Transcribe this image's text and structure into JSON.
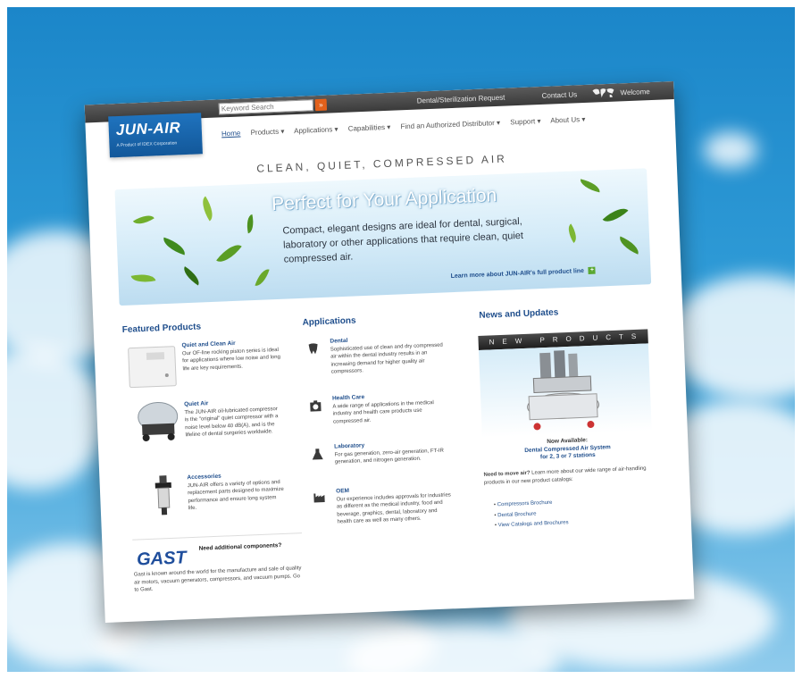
{
  "topbar": {
    "search_placeholder": "Keyword Search",
    "search_button": "»",
    "links": [
      "Dental/Sterilization Request",
      "Contact Us",
      "Welcome"
    ]
  },
  "logo": {
    "name": "JUN-AIR",
    "tagline": "A Product of IDEX Corporation"
  },
  "nav": {
    "items": [
      "Home",
      "Products ▾",
      "Applications ▾",
      "Capabilities ▾",
      "Find an Authorized Distributor ▾",
      "Support ▾",
      "About Us ▾"
    ]
  },
  "headline": "CLEAN, QUIET, COMPRESSED AIR",
  "banner": {
    "title": "Perfect for Your Application",
    "body": "Compact, elegant designs are ideal for dental, surgical, laboratory or other applications that require clean, quiet compressed air.",
    "link": "Learn more about JUN-AIR's full product line"
  },
  "featured": {
    "title": "Featured Products",
    "items": [
      {
        "title": "Quiet and Clean Air",
        "body": "Our OF-line rocking piston series is ideal for applications where low noise and long life are key requirements."
      },
      {
        "title": "Quiet Air",
        "body": "The JUN-AIR oil-lubricated compressor is the \"original\" quiet compressor with a noise level below 40 dB(A), and is the lifeline of dental surgeries worldwide."
      },
      {
        "title": "Accessories",
        "body": "JUN-AIR offers a variety of options and replacement parts designed to maximize performance and ensure long system life."
      }
    ],
    "gast": {
      "logo": "GAST",
      "title": "Need additional components?",
      "body": "Gast is known around the world for the manufacture and sale of quality air motors, vacuum generators, compressors, and vacuum pumps. Go to Gast."
    }
  },
  "applications": {
    "title": "Applications",
    "items": [
      {
        "title": "Dental",
        "body": "Sophisticated use of clean and dry compressed air within the dental industry results in an increasing demand for higher quality air compressors."
      },
      {
        "title": "Health Care",
        "body": "A wide range of applications in the medical industry and health care products use compressed air."
      },
      {
        "title": "Laboratory",
        "body": "For gas generation, zero-air generation, FT-IR generation, and nitrogen generation."
      },
      {
        "title": "OEM",
        "body": "Our experience includes approvals for industries as different as the medical industry, food and beverage, graphics, dental, laboratory and health care as well as many others."
      }
    ]
  },
  "news": {
    "title": "News and Updates",
    "banner": "NEW PRODUCTS",
    "caption_lines": [
      "Now Available:",
      "Dental Compressed Air System",
      "for 2, 3 or 7 stations"
    ],
    "lead_bold": "Need to move air?",
    "lead_rest": " Learn more about our wide range of air-handling products in our new product catalogs:",
    "links": [
      "Compressors Brochure",
      "Dental Brochure",
      "View Catalogs and Brochures"
    ]
  }
}
